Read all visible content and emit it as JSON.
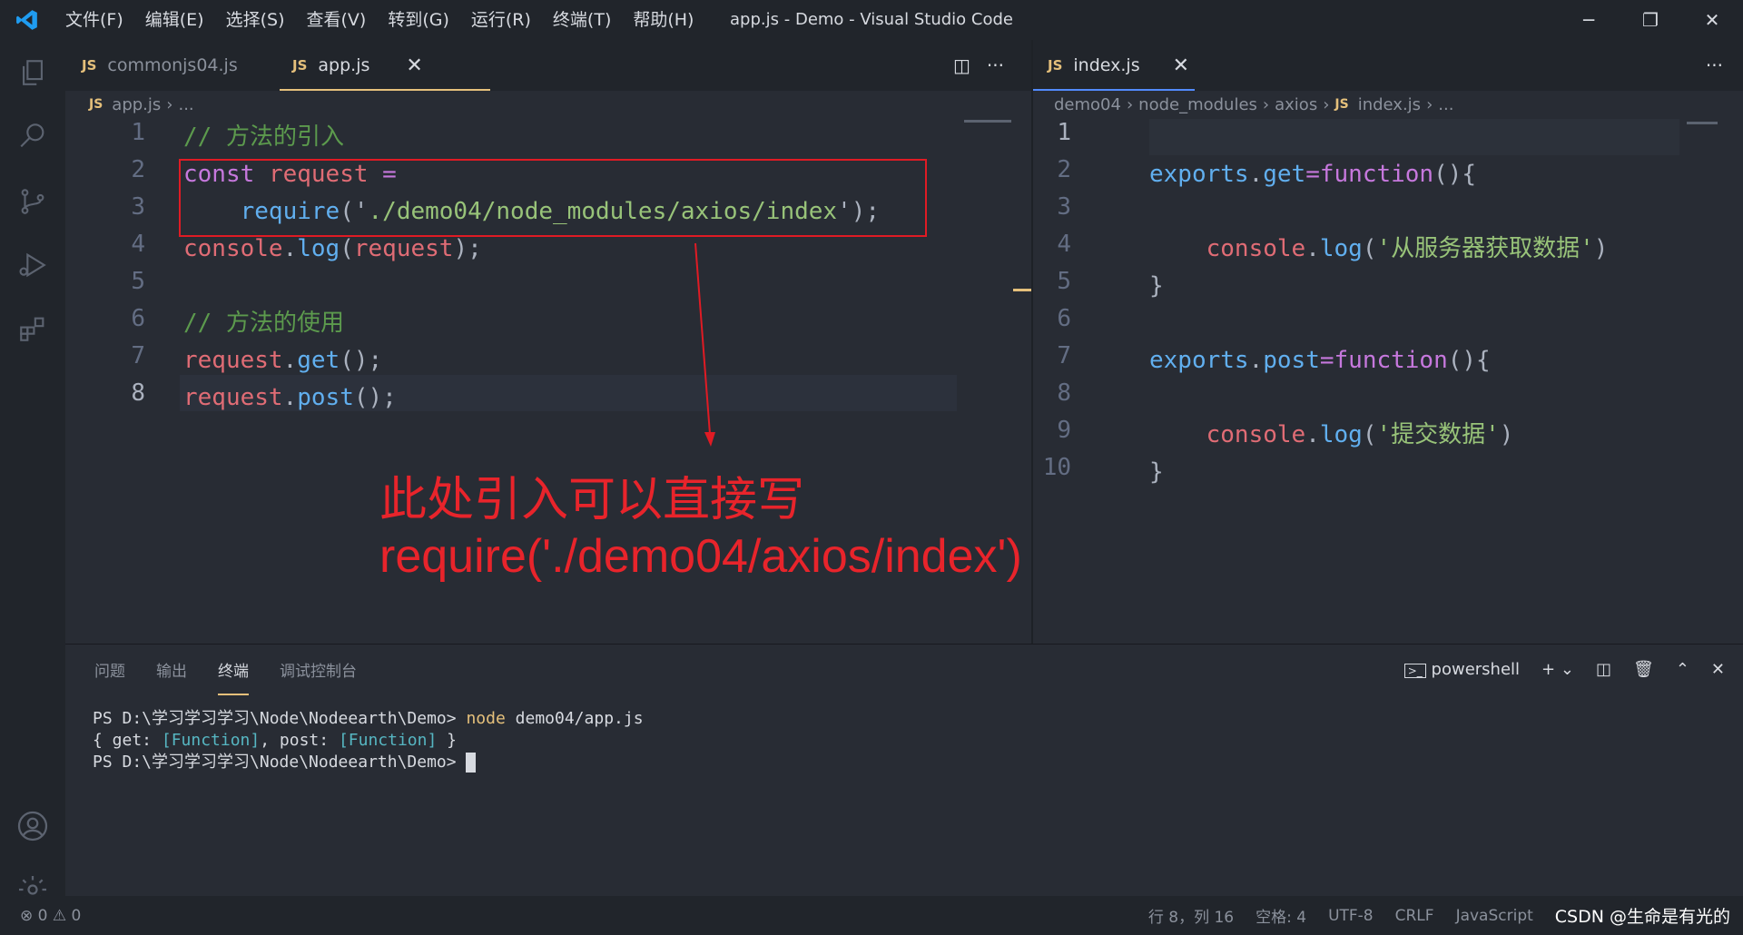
{
  "window": {
    "menu": [
      "文件(F)",
      "编辑(E)",
      "选择(S)",
      "查看(V)",
      "转到(G)",
      "运行(R)",
      "终端(T)",
      "帮助(H)"
    ],
    "title": "app.js - Demo - Visual Studio Code"
  },
  "left_editor": {
    "tabs": [
      {
        "label": "commonjs04.js",
        "icon": "JS"
      },
      {
        "label": "app.js",
        "icon": "JS",
        "active": true
      }
    ],
    "breadcrumb": {
      "file": "app.js",
      "rest": "..."
    },
    "line_numbers": [
      "1",
      "2",
      "3",
      "4",
      "5",
      "6",
      "7",
      "8"
    ],
    "code": {
      "l1": "// 方法的引入",
      "l2_kw": "const",
      "l2_var": "request",
      "l2_op": "=",
      "l3_fn": "require",
      "l3_open": "('",
      "l3_str": "./demo04/node_modules/axios/index",
      "l3_close": "');",
      "l4_var": "console",
      "l4_fn": "log",
      "l4_arg": "request",
      "l6": "// 方法的使用",
      "l7_var": "request",
      "l7_fn": "get",
      "l8_var": "request",
      "l8_fn": "post"
    },
    "annotation": {
      "line1": "此处引入可以直接写",
      "line2": "require('./demo04/axios/index')"
    }
  },
  "right_editor": {
    "tabs": [
      {
        "label": "index.js",
        "icon": "JS",
        "active": true
      }
    ],
    "breadcrumb": [
      "demo04",
      "node_modules",
      "axios",
      "index.js",
      "..."
    ],
    "line_numbers": [
      "1",
      "2",
      "3",
      "4",
      "5",
      "6",
      "7",
      "8",
      "9",
      "10"
    ],
    "code": {
      "l2_obj": "exports",
      "l2_prop": "get",
      "l2_kw": "function",
      "l4_var": "console",
      "l4_fn": "log",
      "l4_str": "'从服务器获取数据'",
      "l7_obj": "exports",
      "l7_prop": "post",
      "l7_kw": "function",
      "l9_var": "console",
      "l9_fn": "log",
      "l9_str": "'提交数据'"
    }
  },
  "panel": {
    "tabs": [
      "问题",
      "输出",
      "终端",
      "调试控制台"
    ],
    "active_tab": "终端",
    "shell": "powershell",
    "terminal": {
      "prompt": "PS D:\\学习学习学习\\Node\\Nodeearth\\Demo>",
      "command": "node",
      "command_arg": "demo04/app.js",
      "output_open": "{ get: ",
      "output_fn1": "[Function]",
      "output_mid": ", post: ",
      "output_fn2": "[Function]",
      "output_close": " }"
    }
  },
  "status": {
    "errors": "0",
    "warnings": "0",
    "position": "行 8，列 16",
    "spaces": "空格: 4",
    "encoding": "UTF-8",
    "eol": "CRLF",
    "language": "JavaScript",
    "watermark": "CSDN @生命是有光的"
  },
  "colors": {
    "accent": "#e5c07b",
    "annotation": "#e8242b",
    "background": "#282c34"
  }
}
